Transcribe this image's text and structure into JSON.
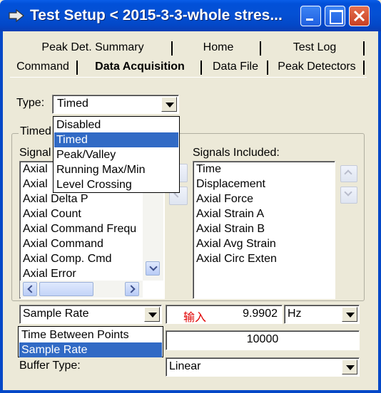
{
  "window": {
    "title": "Test Setup < 2015-3-3-whole stres..."
  },
  "tabs": {
    "row1": [
      "Peak Det. Summary",
      "Home",
      "Test Log"
    ],
    "row2": [
      "Command",
      "Data Acquisition",
      "Data File",
      "Peak Detectors"
    ],
    "active": "Data Acquisition"
  },
  "type_field": {
    "label": "Type:",
    "value": "Timed",
    "options": [
      "Disabled",
      "Timed",
      "Peak/Valley",
      "Running Max/Min",
      "Level Crossing"
    ],
    "highlighted": "Timed"
  },
  "timed_group": {
    "label": "Timed"
  },
  "signals_available": {
    "label": "Signal",
    "items": [
      "Axial",
      "Axial",
      "Axial Delta P",
      "Axial Count",
      "Axial Command Frequ",
      "Axial Command",
      "Axial Comp. Cmd",
      "Axial Error"
    ]
  },
  "signals_included": {
    "label": "Signals Included:",
    "items": [
      "Time",
      "Displacement",
      "Axial Force",
      "Axial Strain A",
      "Axial Strain B",
      "Axial Avg Strain",
      "Axial Circ Exten"
    ]
  },
  "rate": {
    "mode_value": "Sample Rate",
    "mode_options": [
      "Time Between Points",
      "Sample Rate"
    ],
    "mode_highlighted": "Sample Rate",
    "input_hint": "输入",
    "value": "9.9902",
    "unit": "Hz"
  },
  "points": {
    "value": "10000"
  },
  "buffer": {
    "label": "Buffer Type:",
    "value": "Linear"
  },
  "colors": {
    "titlebar": "#0348c8",
    "selection": "#316ac5",
    "hint_text": "#e00000"
  }
}
